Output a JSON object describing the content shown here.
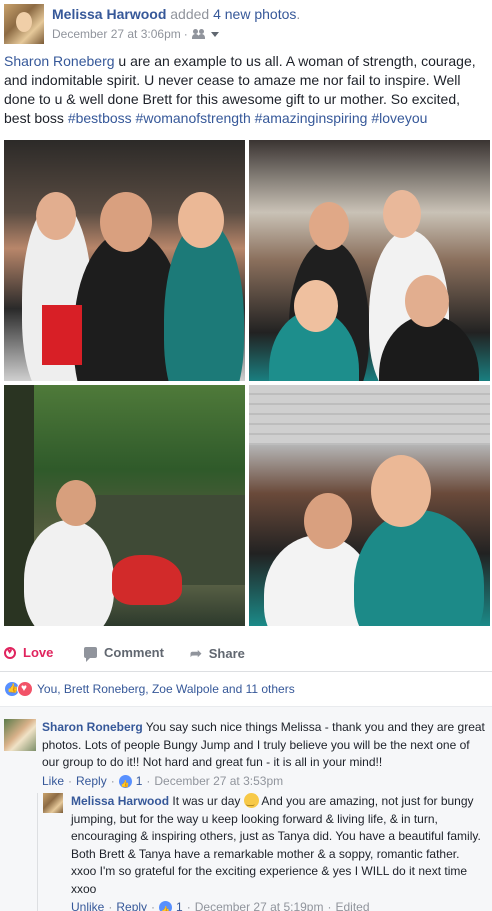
{
  "post": {
    "author": "Melissa Harwood",
    "action_prefix": "added",
    "action_link": "4 new photos",
    "action_suffix": ".",
    "timestamp": "December 27 at 3:06pm",
    "separator": "·",
    "audience_icon": "friends-icon",
    "mention": "Sharon Roneberg",
    "text": " u are an example to us all. A woman of strength, courage, and indomitable spirit. U never cease to amaze me nor fail to inspire. Well done to u & well done Brett for this awesome gift to ur mother. So excited, best boss ",
    "hashtags": [
      "#bestboss",
      "#womanofstrength",
      "#amazinginspiring",
      "#loveyou"
    ]
  },
  "actions": {
    "love_label": "Love",
    "comment_label": "Comment",
    "share_label": "Share"
  },
  "reactions": {
    "summary": "You, Brett Roneberg, Zoe Walpole and 11 others"
  },
  "comments": [
    {
      "author": "Sharon Roneberg",
      "text": " You say such nice things Melissa - thank you and they are great photos. Lots of people Bungy Jump and I truly believe you will be the next one of our group to do it!! Not hard and great fun - it is all in your mind!!",
      "like_label": "Like",
      "reply_label": "Reply",
      "like_count": "1",
      "timestamp": "December 27 at 3:53pm",
      "separator": "·"
    },
    {
      "author": "Melissa Harwood",
      "text_before_emoji": " It was ur day ",
      "text_after_emoji": " And you are amazing, not just for bungy jumping, but for the way u keep looking forward & living life, & in turn, encouraging & inspiring others, just as Tanya did. You have a beautiful family. Both Brett & Tanya have a remarkable mother & a soppy, romantic father. xxoo I'm so grateful for the exciting experience & yes I WILL do it next time xxoo",
      "unlike_label": "Unlike",
      "reply_label": "Reply",
      "like_count": "1",
      "timestamp": "December 27 at 5:19pm",
      "edited_label": "Edited",
      "separator": "·"
    }
  ],
  "colors": {
    "link": "#365899",
    "love": "#e0245e",
    "meta": "#90949c"
  }
}
